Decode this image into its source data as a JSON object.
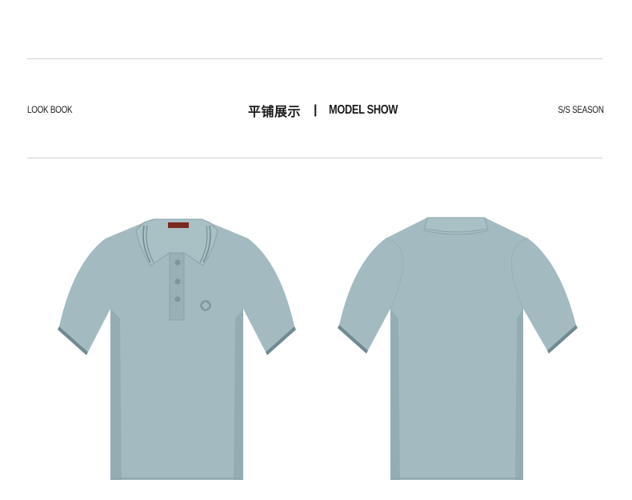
{
  "header": {
    "left_label": "LOOK BOOK",
    "center_cn": "平铺展示",
    "separator": "|",
    "center_en": "MODEL SHOW",
    "right_label": "S/S SEASON"
  },
  "product": {
    "shirt_color": "#a3bbc0",
    "shadow_color": "#8fa7ad",
    "trim_color": "#6f8a90",
    "label_color": "#7a2a1f"
  }
}
